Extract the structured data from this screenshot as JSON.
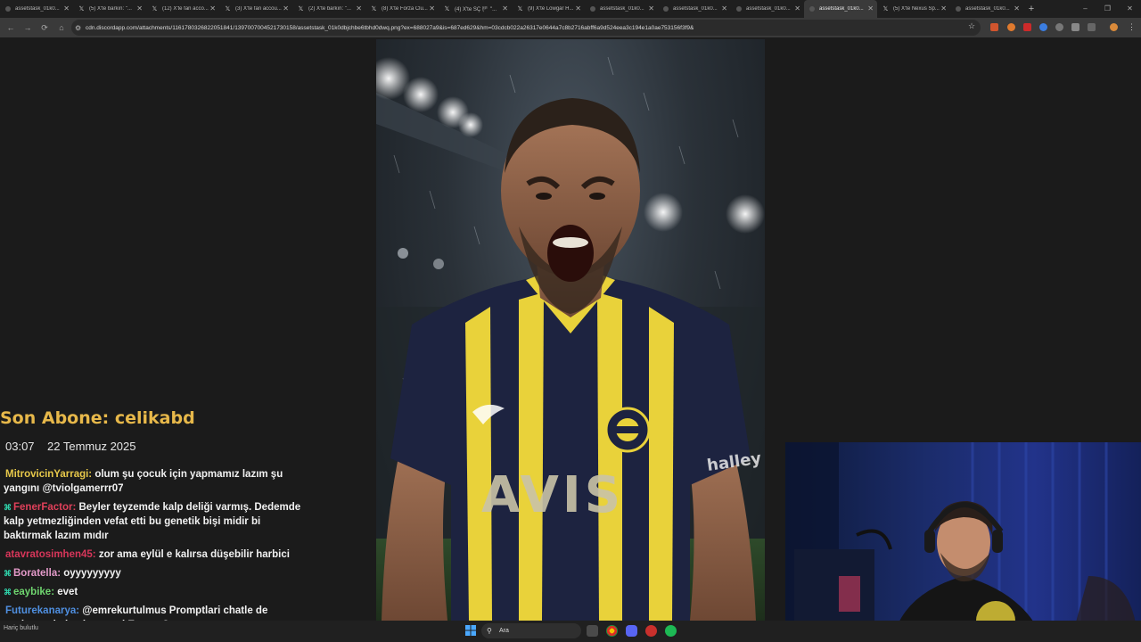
{
  "browser": {
    "tabs": [
      {
        "title": "assetstask_01k0...",
        "icon": "image-icon",
        "active": false
      },
      {
        "title": "(5) X'te barkın: \"...",
        "icon": "x-icon",
        "active": false
      },
      {
        "title": "(12) X'te fan acco...",
        "icon": "x-icon",
        "active": false
      },
      {
        "title": "(3) X'te fan accou...",
        "icon": "x-icon",
        "active": false
      },
      {
        "title": "(2) X'te barkın: \"...",
        "icon": "x-icon",
        "active": false
      },
      {
        "title": "(8) X'te Forza Clu...",
        "icon": "x-icon",
        "active": false
      },
      {
        "title": "(4) X'te SÇ 🏴 \"...",
        "icon": "x-icon",
        "active": false
      },
      {
        "title": "(9) X'te Lowgar H...",
        "icon": "x-icon",
        "active": false
      },
      {
        "title": "assetstask_01k0...",
        "icon": "image-icon",
        "active": false
      },
      {
        "title": "assetstask_01k0...",
        "icon": "image-icon",
        "active": false
      },
      {
        "title": "assetstask_01k0...",
        "icon": "image-icon",
        "active": false
      },
      {
        "title": "assetstask_01k0...",
        "icon": "image-icon",
        "active": true
      },
      {
        "title": "(5) X'te Nexus Sp...",
        "icon": "x-icon",
        "active": false
      },
      {
        "title": "assetstask_01k0...",
        "icon": "image-icon",
        "active": false
      }
    ],
    "new_tab": "+",
    "window_controls": [
      "–",
      "❐",
      "✕"
    ],
    "nav": {
      "back": "←",
      "forward": "→",
      "reload": "⟳",
      "home": "⌂"
    },
    "url": "cdn.discordapp.com/attachments/1161780326822051841/1397007004521730158/assetstask_01k0dbjchbe6tbhd0dwq.png?ex=688027a9&is=687ed629&hm=03cdcb022a26317e0644a7c8b2716abff6a9d524eea3c194e1a0ae753156f3f9&",
    "bookmark": "☆"
  },
  "overlay": {
    "last_sub": "Son Abone: celikabd",
    "time": "03:07",
    "date": "22 Temmuz 2025"
  },
  "chat": [
    {
      "user": "MitrovicinYarragi:",
      "color": "#e7c84a",
      "badge": "",
      "text": " olum şu çocuk için yapmamız lazım şu yangını @tviolgamerrr07"
    },
    {
      "user": "FenerFactor:",
      "color": "#e0405a",
      "badge": "⌘",
      "text": " Beyler teyzemde kalp deliği varmış. Dedemde kalp yetmezliğinden vefat etti bu genetik bişi midir bi baktırmak lazım mıdır"
    },
    {
      "user": "atavratosimhen45:",
      "color": "#d8365a",
      "badge": "",
      "text": " zor ama eylül e kalırsa düşebilir harbici"
    },
    {
      "user": "Boratella:",
      "color": "#e39ac9",
      "badge": "⌘",
      "text": " oyyyyyyyyy"
    },
    {
      "user": "eaybike:",
      "color": "#6fd56f",
      "badge": "⌘",
      "text": " evet"
    },
    {
      "user": "Futurekanarya:",
      "color": "#4f8fe0",
      "badge": "",
      "text": " @emrekurtulmus Promptlari chatle de paylasma imkanin var mi Emrem?"
    }
  ],
  "taskbar": {
    "search_placeholder": "Ara",
    "corner_label": "Hariç bulutlu"
  },
  "colors": {
    "accent_title": "#e7b84a",
    "kit_yellow": "#e9d23a",
    "kit_navy": "#1d2340"
  }
}
